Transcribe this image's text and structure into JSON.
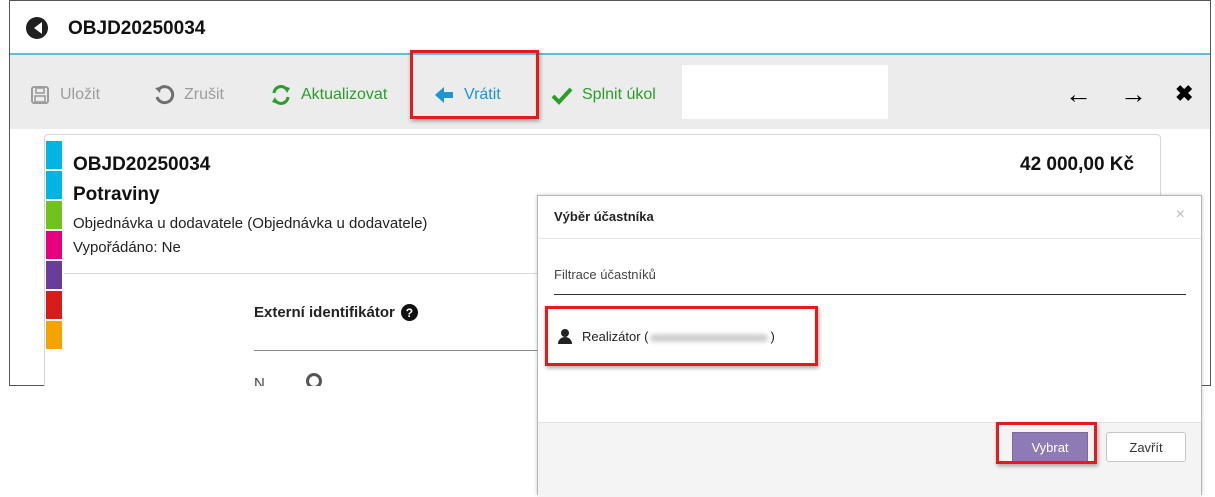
{
  "window": {
    "title": "OBJD20250034"
  },
  "toolbar": {
    "save_label": "Uložit",
    "cancel_label": "Zrušit",
    "refresh_label": "Aktualizovat",
    "return_label": "Vrátit",
    "complete_label": "Splnit úkol",
    "back_icon": "←",
    "forward_icon": "→",
    "close_icon": "✖"
  },
  "document": {
    "number": "OBJD20250034",
    "price": "42 000,00 Kč",
    "name": "Potraviny",
    "type": "Objednávka u dodavatele (Objednávka u dodavatele)",
    "settled": "Vypořádáno: Ne",
    "external_id_label": "Externí identifikátor",
    "cut_off_label": "N...",
    "stripe_colors": [
      "#00b4e6",
      "#00b4e6",
      "#72c21e",
      "#e6007e",
      "#6a3d9a",
      "#d81b1b",
      "#f5a300"
    ]
  },
  "dialog": {
    "title": "Výběr účastníka",
    "close_icon": "×",
    "filter_placeholder": "Filtrace účastníků",
    "participant_prefix": "Realizátor (",
    "participant_suffix": ")",
    "select_button": "Vybrat",
    "close_button": "Zavřít"
  },
  "colors": {
    "accent_line": "#5bc0de",
    "highlight": "#e31b1b",
    "primary_button": "#8e7bb6",
    "success": "#2a9d2a",
    "return_blue": "#1f94d2"
  }
}
